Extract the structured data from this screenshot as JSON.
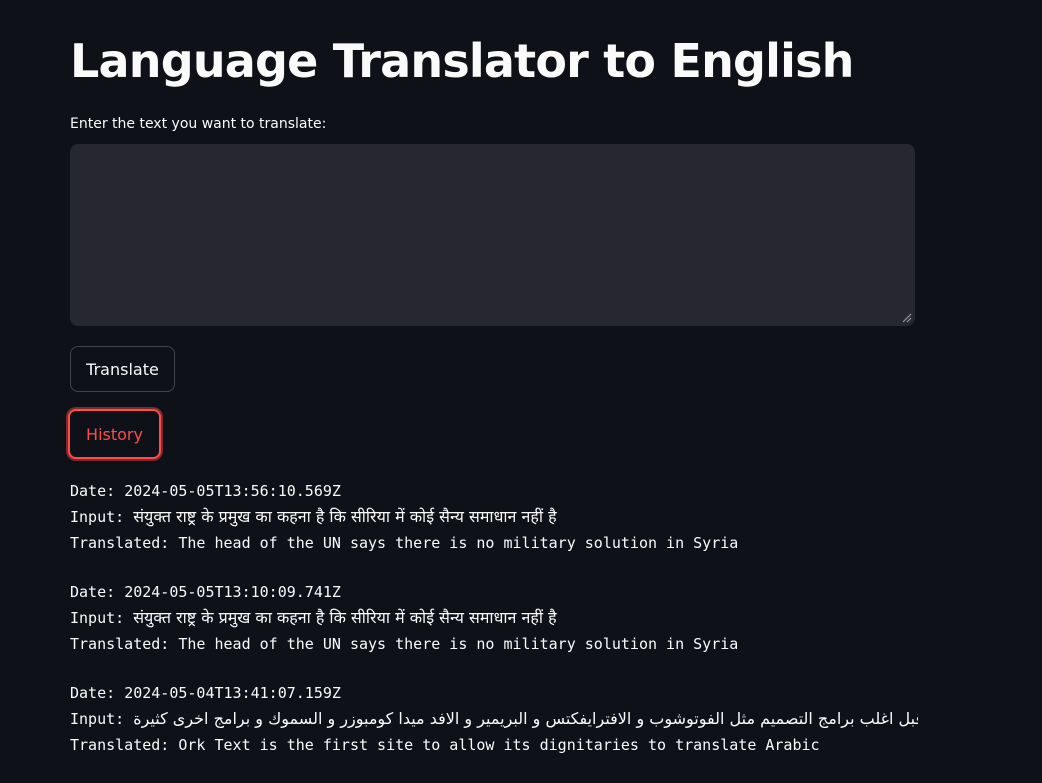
{
  "header": {
    "title": "Language Translator to English"
  },
  "form": {
    "input_label": "Enter the text you want to translate:",
    "input_value": "",
    "input_placeholder": ""
  },
  "buttons": {
    "translate_label": "Translate",
    "history_label": "History"
  },
  "history": {
    "date_prefix": "Date:",
    "input_prefix": "Input:",
    "translated_prefix": "Translated:",
    "entries": [
      {
        "date": "2024-05-05T13:56:10.569Z",
        "input": "संयुक्त राष्ट्र के प्रमुख का कहना है कि सीरिया में कोई सैन्य समाधान नहीं है",
        "translated": "The head of the UN says there is no military solution in Syria"
      },
      {
        "date": "2024-05-05T13:10:09.741Z",
        "input": "संयुक्त राष्ट्र के प्रमुख का कहना है कि सीरिया में कोई सैन्य समाधान नहीं है",
        "translated": "The head of the UN says there is no military solution in Syria"
      },
      {
        "date": "2024-05-04T13:41:07.159Z",
        "input": "ن قبل اغلب برامج التصميم مثل الفوتوشوب و الافترايفكتس و البريمير و الافد ميدا كومبوزر و السموك و برامج اخرى كثيرة",
        "translated": "Ork Text is the first site to allow its dignitaries to translate Arabic"
      }
    ]
  },
  "colors": {
    "background": "#0e1117",
    "input_background": "#262730",
    "accent": "#ff4b4b",
    "text": "#fafafa"
  }
}
